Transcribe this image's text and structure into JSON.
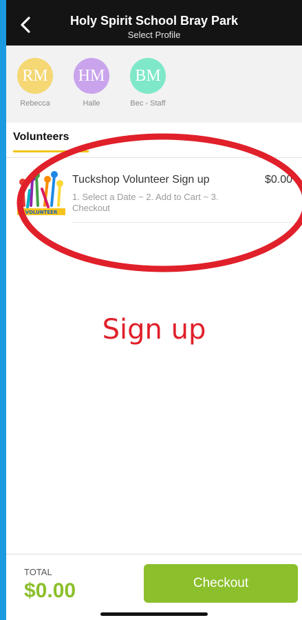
{
  "header": {
    "title": "Holy Spirit School Bray Park",
    "subtitle": "Select Profile"
  },
  "profiles": [
    {
      "initials": "RM",
      "name": "Rebecca",
      "color": "#f5d774"
    },
    {
      "initials": "HM",
      "name": "Halle",
      "color": "#c9a4ec"
    },
    {
      "initials": "BM",
      "name": "Bec - Staff",
      "color": "#7fe8c9"
    }
  ],
  "tabs": [
    {
      "label": "Volunteers"
    }
  ],
  "products": [
    {
      "name": "Tuckshop Volunteer Sign up",
      "price": "$0.00",
      "description": "1. Select a Date  ~ 2. Add to Cart  ~ 3. Checkout",
      "image_label": "VOLUNTEER"
    }
  ],
  "annotation": {
    "text": "Sign up",
    "color": "#e0202a"
  },
  "footer": {
    "total_label": "TOTAL",
    "total_value": "$0.00",
    "checkout_label": "Checkout"
  },
  "colors": {
    "accent": "#8cbf2c",
    "topbar": "#141414",
    "tab_underline": "#f0c419",
    "frame": "#1a9ae0"
  },
  "icons": {
    "back": "chevron-left-icon"
  }
}
